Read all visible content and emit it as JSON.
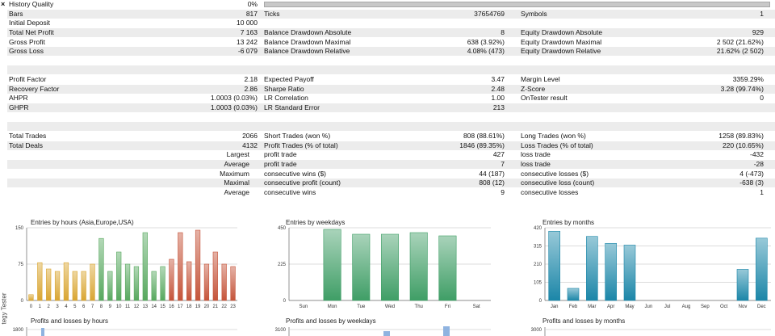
{
  "strip": {
    "close_glyph": "×",
    "label": "tegy Tester"
  },
  "header": {
    "history_quality_label": "History Quality",
    "history_quality_value": "0%"
  },
  "rows": [
    [
      {
        "t": "Bars"
      },
      {
        "t": "817"
      },
      {
        "t": "Ticks"
      },
      {
        "t": "37654769"
      },
      {
        "t": "Symbols"
      },
      {
        "t": "1"
      }
    ],
    [
      {
        "t": "Initial Deposit"
      },
      {
        "t": "10 000"
      },
      {
        "t": ""
      },
      {
        "t": ""
      },
      {
        "t": ""
      },
      {
        "t": ""
      }
    ],
    [
      {
        "t": "Total Net Profit"
      },
      {
        "t": "7 163"
      },
      {
        "t": "Balance Drawdown Absolute"
      },
      {
        "t": "8"
      },
      {
        "t": "Equity Drawdown Absolute"
      },
      {
        "t": "929"
      }
    ],
    [
      {
        "t": "Gross Profit"
      },
      {
        "t": "13 242"
      },
      {
        "t": "Balance Drawdown Maximal"
      },
      {
        "t": "638 (3.92%)"
      },
      {
        "t": "Equity Drawdown Maximal"
      },
      {
        "t": "2 502 (21.62%)"
      }
    ],
    [
      {
        "t": "Gross Loss"
      },
      {
        "t": "-6 079"
      },
      {
        "t": "Balance Drawdown Relative"
      },
      {
        "t": "4.08% (473)"
      },
      {
        "t": "Equity Drawdown Relative"
      },
      {
        "t": "21.62% (2 502)"
      }
    ],
    [
      {
        "t": ""
      },
      {
        "t": ""
      },
      {
        "t": ""
      },
      {
        "t": ""
      },
      {
        "t": ""
      },
      {
        "t": ""
      }
    ],
    [
      {
        "t": ""
      },
      {
        "t": ""
      },
      {
        "t": ""
      },
      {
        "t": ""
      },
      {
        "t": ""
      },
      {
        "t": ""
      }
    ],
    [
      {
        "t": "Profit Factor"
      },
      {
        "t": "2.18"
      },
      {
        "t": "Expected Payoff"
      },
      {
        "t": "3.47"
      },
      {
        "t": "Margin Level"
      },
      {
        "t": "3359.29%"
      }
    ],
    [
      {
        "t": "Recovery Factor"
      },
      {
        "t": "2.86"
      },
      {
        "t": "Sharpe Ratio"
      },
      {
        "t": "2.48"
      },
      {
        "t": "Z-Score"
      },
      {
        "t": "3.28 (99.74%)"
      }
    ],
    [
      {
        "t": "AHPR"
      },
      {
        "t": "1.0003 (0.03%)"
      },
      {
        "t": "LR Correlation"
      },
      {
        "t": "1.00"
      },
      {
        "t": "OnTester result"
      },
      {
        "t": "0"
      }
    ],
    [
      {
        "t": "GHPR"
      },
      {
        "t": "1.0003 (0.03%)"
      },
      {
        "t": "LR Standard Error"
      },
      {
        "t": "213"
      },
      {
        "t": ""
      },
      {
        "t": ""
      }
    ],
    [
      {
        "t": ""
      },
      {
        "t": ""
      },
      {
        "t": ""
      },
      {
        "t": ""
      },
      {
        "t": ""
      },
      {
        "t": ""
      }
    ],
    [
      {
        "t": ""
      },
      {
        "t": ""
      },
      {
        "t": ""
      },
      {
        "t": ""
      },
      {
        "t": ""
      },
      {
        "t": ""
      }
    ],
    [
      {
        "t": "Total Trades"
      },
      {
        "t": "2066"
      },
      {
        "t": "Short Trades (won %)"
      },
      {
        "t": "808 (88.61%)"
      },
      {
        "t": "Long Trades (won %)"
      },
      {
        "t": "1258 (89.83%)"
      }
    ],
    [
      {
        "t": "Total Deals"
      },
      {
        "t": "4132"
      },
      {
        "t": "Profit Trades (% of total)"
      },
      {
        "t": "1846 (89.35%)"
      },
      {
        "t": "Loss Trades (% of total)"
      },
      {
        "t": "220 (10.65%)"
      }
    ],
    [
      {
        "t": "Largest",
        "r": true
      },
      {
        "t": ""
      },
      {
        "t": "profit trade"
      },
      {
        "t": "427"
      },
      {
        "t": "loss trade"
      },
      {
        "t": "-432"
      }
    ],
    [
      {
        "t": "Average",
        "r": true
      },
      {
        "t": ""
      },
      {
        "t": "profit trade"
      },
      {
        "t": "7"
      },
      {
        "t": "loss trade"
      },
      {
        "t": "-28"
      }
    ],
    [
      {
        "t": "Maximum",
        "r": true
      },
      {
        "t": ""
      },
      {
        "t": "consecutive wins ($)"
      },
      {
        "t": "44 (187)"
      },
      {
        "t": "consecutive losses ($)"
      },
      {
        "t": "4 (-473)"
      }
    ],
    [
      {
        "t": "Maximal",
        "r": true
      },
      {
        "t": ""
      },
      {
        "t": "consecutive profit (count)"
      },
      {
        "t": "808 (12)"
      },
      {
        "t": "consecutive loss (count)"
      },
      {
        "t": "-638 (3)"
      }
    ],
    [
      {
        "t": "Average",
        "r": true
      },
      {
        "t": ""
      },
      {
        "t": "consecutive wins"
      },
      {
        "t": "9"
      },
      {
        "t": "consecutive losses"
      },
      {
        "t": "1"
      }
    ]
  ],
  "chart_data": [
    {
      "type": "bar",
      "title": "Entries by hours (Asia,Europe,USA)",
      "categories": [
        "0",
        "1",
        "2",
        "3",
        "4",
        "5",
        "6",
        "7",
        "8",
        "9",
        "10",
        "11",
        "12",
        "13",
        "14",
        "15",
        "16",
        "17",
        "18",
        "19",
        "20",
        "21",
        "22",
        "23"
      ],
      "values": [
        12,
        78,
        65,
        60,
        78,
        60,
        60,
        75,
        128,
        60,
        100,
        75,
        70,
        140,
        60,
        70,
        85,
        140,
        80,
        145,
        75,
        100,
        75,
        70
      ],
      "colors": [
        "#d9a531",
        "#d9a531",
        "#d9a531",
        "#d9a531",
        "#d9a531",
        "#d9a531",
        "#d9a531",
        "#d9a531",
        "#57a85e",
        "#57a85e",
        "#57a85e",
        "#57a85e",
        "#57a85e",
        "#57a85e",
        "#57a85e",
        "#57a85e",
        "#c5543a",
        "#c5543a",
        "#c5543a",
        "#c5543a",
        "#c5543a",
        "#c5543a",
        "#c5543a",
        "#c5543a"
      ],
      "ylim": [
        0,
        150
      ],
      "yticks": [
        "0",
        "75",
        "150"
      ]
    },
    {
      "type": "bar",
      "title": "Entries by weekdays",
      "categories": [
        "Sun",
        "Mon",
        "Tue",
        "Wed",
        "Thu",
        "Fri",
        "Sat"
      ],
      "values": [
        0,
        440,
        410,
        410,
        420,
        400,
        0
      ],
      "colors": [
        "#3f9e66"
      ],
      "ylim": [
        0,
        450
      ],
      "yticks": [
        "0",
        "225",
        "450"
      ]
    },
    {
      "type": "bar",
      "title": "Entries by months",
      "categories": [
        "Jan",
        "Feb",
        "Mar",
        "Apr",
        "May",
        "Jun",
        "Jul",
        "Aug",
        "Sep",
        "Oct",
        "Nov",
        "Dec"
      ],
      "values": [
        400,
        70,
        370,
        330,
        320,
        0,
        0,
        0,
        0,
        0,
        180,
        360
      ],
      "colors": [
        "#1b86a8"
      ],
      "ylim": [
        0,
        420
      ],
      "yticks": [
        "0",
        "105",
        "210",
        "315",
        "420"
      ]
    }
  ],
  "footer_charts": [
    {
      "title": "Profits and losses by hours",
      "ymax": "1800"
    },
    {
      "title": "Profits and losses by weekdays",
      "ymax": "3100"
    },
    {
      "title": "Profits and losses by months",
      "ymax": "3000"
    }
  ]
}
